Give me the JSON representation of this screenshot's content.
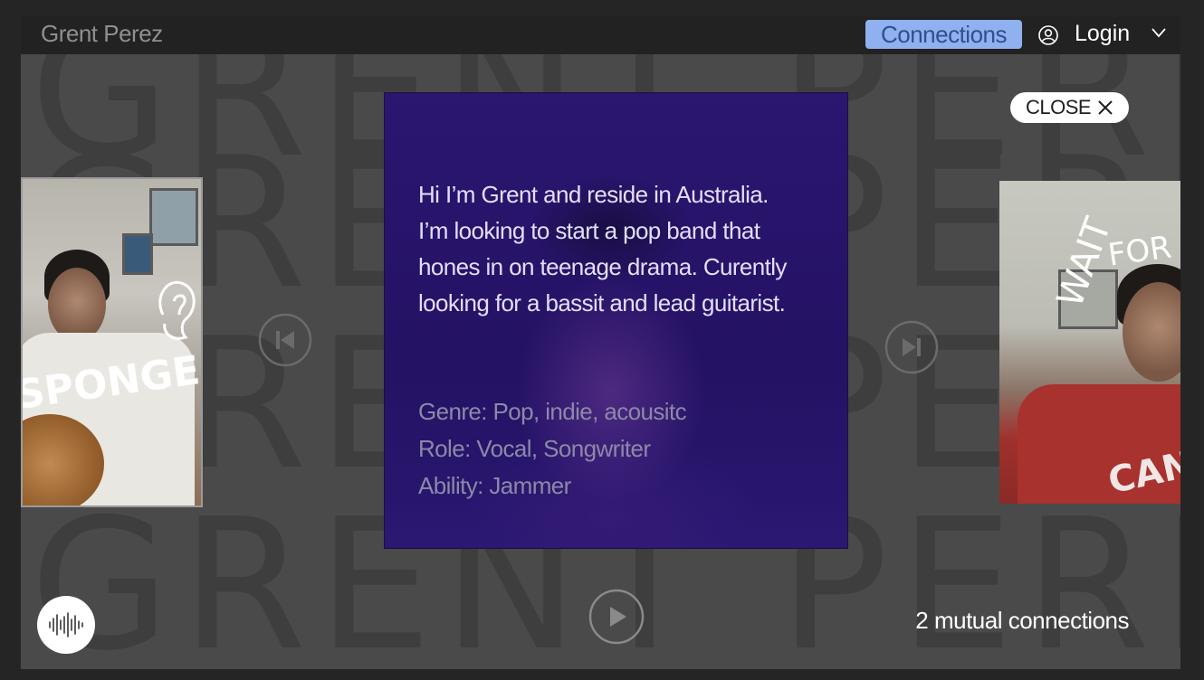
{
  "header": {
    "app_title": "Grent Perez",
    "connections_label": "Connections",
    "login_label": "Login"
  },
  "background": {
    "watermark_text": "GRENT PEREZ"
  },
  "photos": {
    "left_caption": "SPONGE",
    "right_caption_1": "FOR",
    "right_caption_2": "WAIT",
    "right_shirt_text": "CAN"
  },
  "profile_card": {
    "bio_lines": [
      "Hi I’m Grent and reside in Australia.",
      "I’m looking to start a pop band that",
      "hones in on teenage drama. Curently",
      "looking for a bassit and lead guitarist."
    ],
    "genre": "Genre: Pop, indie, acousitc",
    "role": "Role: Vocal, Songwriter",
    "ability": "Ability: Jammer"
  },
  "close_button": {
    "label": "CLOSE"
  },
  "footer": {
    "mutual_connections": "2 mutual connections"
  },
  "colors": {
    "page_bg": "#252525",
    "frame_bg": "#4a4a4a",
    "topbar_bg": "#222222",
    "connections_bg": "#8fb1ef",
    "card_bg": "#23105a",
    "text_white": "#ffffff"
  },
  "icons": {
    "user": "user-circle-icon",
    "chevron": "chevron-down-icon",
    "previous": "skip-previous-icon",
    "next": "skip-next-icon",
    "play": "play-icon",
    "close": "close-icon",
    "audio": "audio-waveform-icon"
  }
}
